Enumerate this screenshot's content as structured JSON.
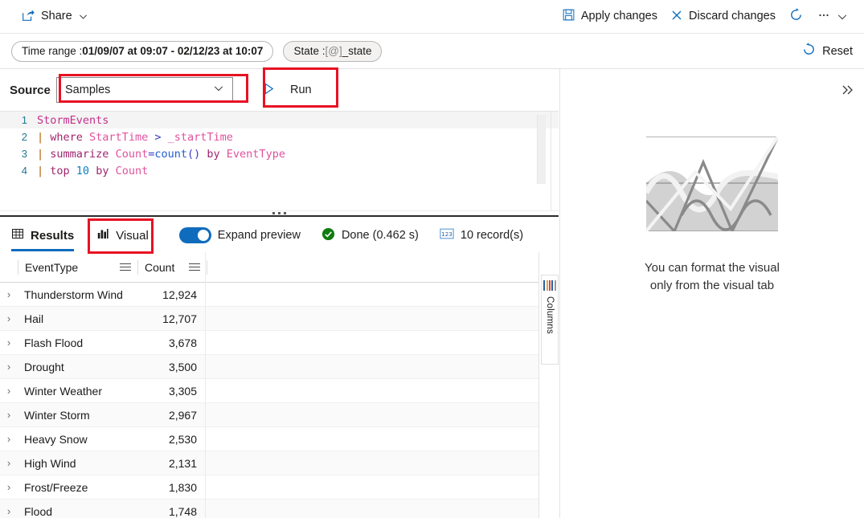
{
  "command_bar": {
    "share": {
      "label": "Share",
      "icon": "share-icon",
      "chevron": "chevron-down-icon"
    },
    "apply": {
      "label": "Apply changes",
      "icon": "save-icon"
    },
    "discard": {
      "label": "Discard changes",
      "icon": "close-icon"
    },
    "refresh": {
      "icon": "refresh-icon"
    },
    "overflow": {
      "icon": "ellipsis-icon",
      "chevron": "chevron-down-icon"
    }
  },
  "filter_bar": {
    "time_range": {
      "prefix": "Time range : ",
      "value": "01/09/07 at 09:07 - 02/12/23 at 10:07"
    },
    "state": {
      "prefix": "State : ",
      "token": "[@]",
      "value": "_state"
    },
    "reset": {
      "label": "Reset",
      "icon": "reset-icon"
    }
  },
  "source_row": {
    "label": "Source",
    "dropdown": {
      "value": "Samples",
      "chevron": "chevron-down-icon"
    },
    "run": {
      "label": "Run",
      "icon": "play-icon"
    }
  },
  "editor": {
    "lines": [
      {
        "n": "1",
        "tokens": [
          {
            "t": "StormEvents",
            "c": "tok-table"
          }
        ]
      },
      {
        "n": "2",
        "tokens": [
          {
            "t": "| ",
            "c": "tok-pipe"
          },
          {
            "t": "where",
            "c": "tok-kw"
          },
          {
            "t": " ",
            "c": "tok-plain"
          },
          {
            "t": "StartTime",
            "c": "tok-col"
          },
          {
            "t": " ",
            "c": "tok-plain"
          },
          {
            "t": ">",
            "c": "tok-op"
          },
          {
            "t": " ",
            "c": "tok-plain"
          },
          {
            "t": "_startTime",
            "c": "tok-var"
          }
        ]
      },
      {
        "n": "3",
        "tokens": [
          {
            "t": "| ",
            "c": "tok-pipe"
          },
          {
            "t": "summarize",
            "c": "tok-kw"
          },
          {
            "t": " ",
            "c": "tok-plain"
          },
          {
            "t": "Count",
            "c": "tok-col"
          },
          {
            "t": "=",
            "c": "tok-op"
          },
          {
            "t": "count",
            "c": "tok-fn"
          },
          {
            "t": "()",
            "c": "tok-op"
          },
          {
            "t": " ",
            "c": "tok-plain"
          },
          {
            "t": "by",
            "c": "tok-kw2"
          },
          {
            "t": " ",
            "c": "tok-plain"
          },
          {
            "t": "EventType",
            "c": "tok-col"
          }
        ]
      },
      {
        "n": "4",
        "tokens": [
          {
            "t": "| ",
            "c": "tok-pipe"
          },
          {
            "t": "top",
            "c": "tok-kw"
          },
          {
            "t": " ",
            "c": "tok-plain"
          },
          {
            "t": "10",
            "c": "tok-num"
          },
          {
            "t": " ",
            "c": "tok-plain"
          },
          {
            "t": "by",
            "c": "tok-kw2"
          },
          {
            "t": " ",
            "c": "tok-plain"
          },
          {
            "t": "Count",
            "c": "tok-col"
          }
        ]
      }
    ]
  },
  "results_panel": {
    "tabs": [
      {
        "label": "Results",
        "icon": "table-icon",
        "selected": true
      },
      {
        "label": "Visual",
        "icon": "chart-icon",
        "selected": false
      }
    ],
    "expand_preview": {
      "label": "Expand preview",
      "on": true
    },
    "status": {
      "label": "Done (0.462 s)",
      "icon": "success-check-icon"
    },
    "records": {
      "label": "10 record(s)",
      "icon": "number-123-icon"
    },
    "columns_rail": {
      "label": "Columns",
      "icon": "columns-icon"
    }
  },
  "table": {
    "columns": [
      {
        "key": "EventType",
        "label": "EventType",
        "align": "left"
      },
      {
        "key": "Count",
        "label": "Count",
        "align": "right"
      }
    ],
    "rows": [
      {
        "EventType": "Thunderstorm Wind",
        "Count": "12,924"
      },
      {
        "EventType": "Hail",
        "Count": "12,707"
      },
      {
        "EventType": "Flash Flood",
        "Count": "3,678"
      },
      {
        "EventType": "Drought",
        "Count": "3,500"
      },
      {
        "EventType": "Winter Weather",
        "Count": "3,305"
      },
      {
        "EventType": "Winter Storm",
        "Count": "2,967"
      },
      {
        "EventType": "Heavy Snow",
        "Count": "2,530"
      },
      {
        "EventType": "High Wind",
        "Count": "2,131"
      },
      {
        "EventType": "Frost/Freeze",
        "Count": "1,830"
      },
      {
        "EventType": "Flood",
        "Count": "1,748"
      }
    ],
    "row_expand_icon": "chevron-right-icon"
  },
  "visual_pane": {
    "expand_icon": "double-chevron-right-icon",
    "empty_message_line1": "You can format the visual",
    "empty_message_line2": "only from the visual tab",
    "placeholder_icon": "chart-placeholder-icon"
  },
  "annotations": [
    {
      "name": "source-dropdown-highlight"
    },
    {
      "name": "run-button-highlight"
    },
    {
      "name": "visual-tab-highlight"
    }
  ],
  "colors": {
    "accent": "#0f6cbd",
    "annotation": "#e81123",
    "success": "#107c10",
    "line_number": "#237893"
  }
}
